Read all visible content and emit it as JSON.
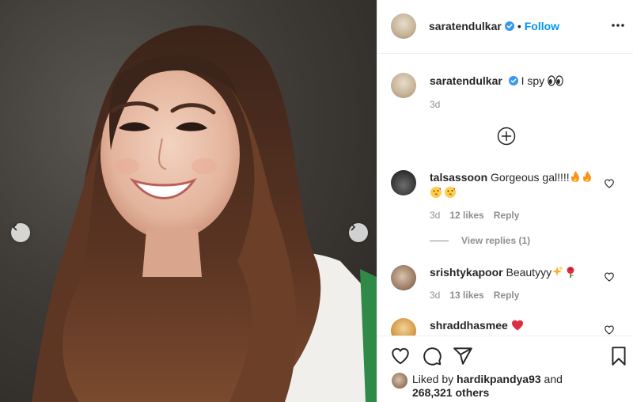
{
  "post": {
    "author": "saratendulkar",
    "follow_label": "Follow",
    "separator": "•",
    "caption": {
      "username": "saratendulkar",
      "text": "I spy",
      "emoji": "eyes",
      "time": "3d"
    }
  },
  "comments": [
    {
      "username": "talsassoon",
      "text_line1": "Gorgeous gal!!!!",
      "emoji_line1": [
        "fire",
        "fire"
      ],
      "emoji_line2": [
        "kiss-face",
        "kiss-face"
      ],
      "time": "3d",
      "likes": "12 likes",
      "reply_label": "Reply",
      "view_replies": "View replies (1)"
    },
    {
      "username": "srishtykapoor",
      "text": "Beautyyy",
      "emoji": [
        "sparkles",
        "rose"
      ],
      "time": "3d",
      "likes": "13 likes",
      "reply_label": "Reply"
    },
    {
      "username": "shraddhasmee",
      "emoji": [
        "red-heart"
      ]
    }
  ],
  "footer": {
    "liked_by_prefix": "Liked by",
    "liked_by_user": "hardikpandya93",
    "and_label": "and",
    "others": "268,321 others"
  },
  "icons": {
    "verified": "verified-badge-icon",
    "more": "more-options-icon",
    "add_comment": "plus-circle-icon",
    "like": "heart-icon",
    "comment": "comment-icon",
    "share": "paper-plane-icon",
    "save": "bookmark-icon",
    "prev": "chevron-left-icon",
    "next": "chevron-right-icon"
  },
  "colors": {
    "accent": "#0095f6",
    "verified": "#3897f0",
    "muted": "#8e8e8e",
    "text": "#262626"
  }
}
